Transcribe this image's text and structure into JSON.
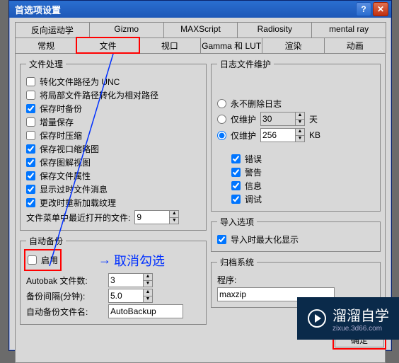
{
  "window": {
    "title": "首选项设置"
  },
  "tabs_row1": [
    "反向运动学",
    "Gizmo",
    "MAXScript",
    "Radiosity",
    "mental ray"
  ],
  "tabs_row2": [
    "常规",
    "文件",
    "视口",
    "Gamma 和 LUT",
    "渲染",
    "动画"
  ],
  "active_tab_index": 1,
  "file_handling": {
    "legend": "文件处理",
    "items": [
      {
        "label": "转化文件路径为 UNC",
        "checked": false
      },
      {
        "label": "将局部文件路径转化为相对路径",
        "checked": false
      },
      {
        "label": "保存时备份",
        "checked": true
      },
      {
        "label": "增量保存",
        "checked": false
      },
      {
        "label": "保存时压缩",
        "checked": false
      },
      {
        "label": "保存视口缩略图",
        "checked": true
      },
      {
        "label": "保存图解视图",
        "checked": true
      },
      {
        "label": "保存文件属性",
        "checked": true
      },
      {
        "label": "显示过时文件消息",
        "checked": true
      },
      {
        "label": "更改时重新加载纹理",
        "checked": true
      }
    ],
    "recent_label": "文件菜单中最近打开的文件:",
    "recent_value": "9"
  },
  "auto_backup": {
    "legend": "自动备份",
    "enable_label": "启用",
    "enable_checked": false,
    "annot": "取消勾选",
    "rows": [
      {
        "label": "Autobak 文件数:",
        "value": "3"
      },
      {
        "label": "备份间隔(分钟):",
        "value": "5.0"
      }
    ],
    "name_label": "自动备份文件名:",
    "name_value": "AutoBackup"
  },
  "log_maint": {
    "legend": "日志文件维护",
    "never_label": "永不删除日志",
    "maint1_label": "仅维护",
    "maint1_value": "30",
    "maint1_unit": "天",
    "maint2_label": "仅维护",
    "maint2_value": "256",
    "maint2_unit": "KB",
    "radio_selected": 2,
    "checks": [
      {
        "label": "错误",
        "checked": true
      },
      {
        "label": "警告",
        "checked": true
      },
      {
        "label": "信息",
        "checked": true
      },
      {
        "label": "调试",
        "checked": true
      }
    ]
  },
  "import_opts": {
    "legend": "导入选项",
    "item_label": "导入时最大化显示",
    "item_checked": true
  },
  "archive": {
    "legend": "归档系统",
    "prog_label": "程序:",
    "prog_value": "maxzip"
  },
  "buttons": {
    "ok": "确定"
  },
  "watermark": {
    "brand": "溜溜自学",
    "sub": "zixue.3d66.com"
  }
}
